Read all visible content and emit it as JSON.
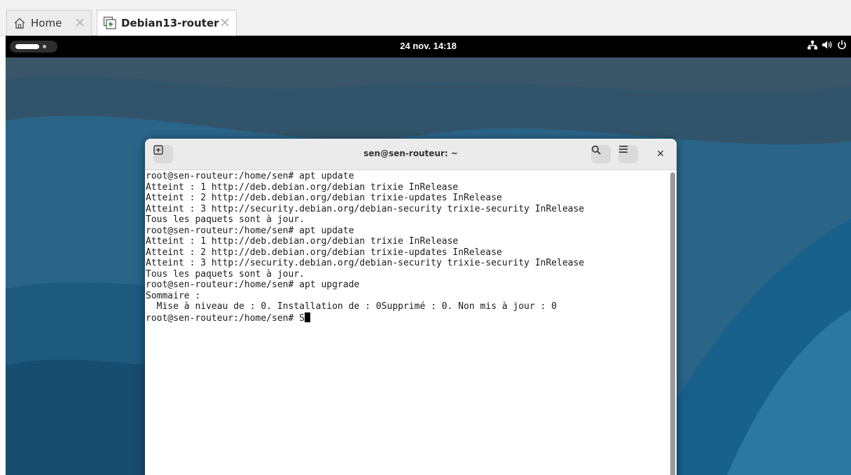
{
  "host_tabs": [
    {
      "label": "Home",
      "icon": "home-icon"
    },
    {
      "label": "Debian13-router",
      "icon": "vm-play-icon"
    }
  ],
  "topbar": {
    "clock": "24 nov.  14:18",
    "tray_icons": [
      "network-icon",
      "volume-icon",
      "power-icon"
    ]
  },
  "terminal": {
    "title": "sen@sen-routeur: ~",
    "lines": [
      "root@sen-routeur:/home/sen# apt update",
      "Atteint : 1 http://deb.debian.org/debian trixie InRelease",
      "Atteint : 2 http://deb.debian.org/debian trixie-updates InRelease",
      "Atteint : 3 http://security.debian.org/debian-security trixie-security InRelease",
      "Tous les paquets sont à jour.",
      "root@sen-routeur:/home/sen# apt update",
      "Atteint : 1 http://deb.debian.org/debian trixie InRelease",
      "Atteint : 2 http://deb.debian.org/debian trixie-updates InRelease",
      "Atteint : 3 http://security.debian.org/debian-security trixie-security InRelease",
      "Tous les paquets sont à jour.",
      "root@sen-routeur:/home/sen# apt upgrade",
      "Sommaire :",
      "  Mise à niveau de : 0. Installation de : 0Supprimé : 0. Non mis à jour : 0"
    ],
    "prompt": "root@sen-routeur:/home/sen# S"
  },
  "colors": {
    "desktop": "#1e5578",
    "topbar": "#000000",
    "header": "#ebebeb"
  }
}
